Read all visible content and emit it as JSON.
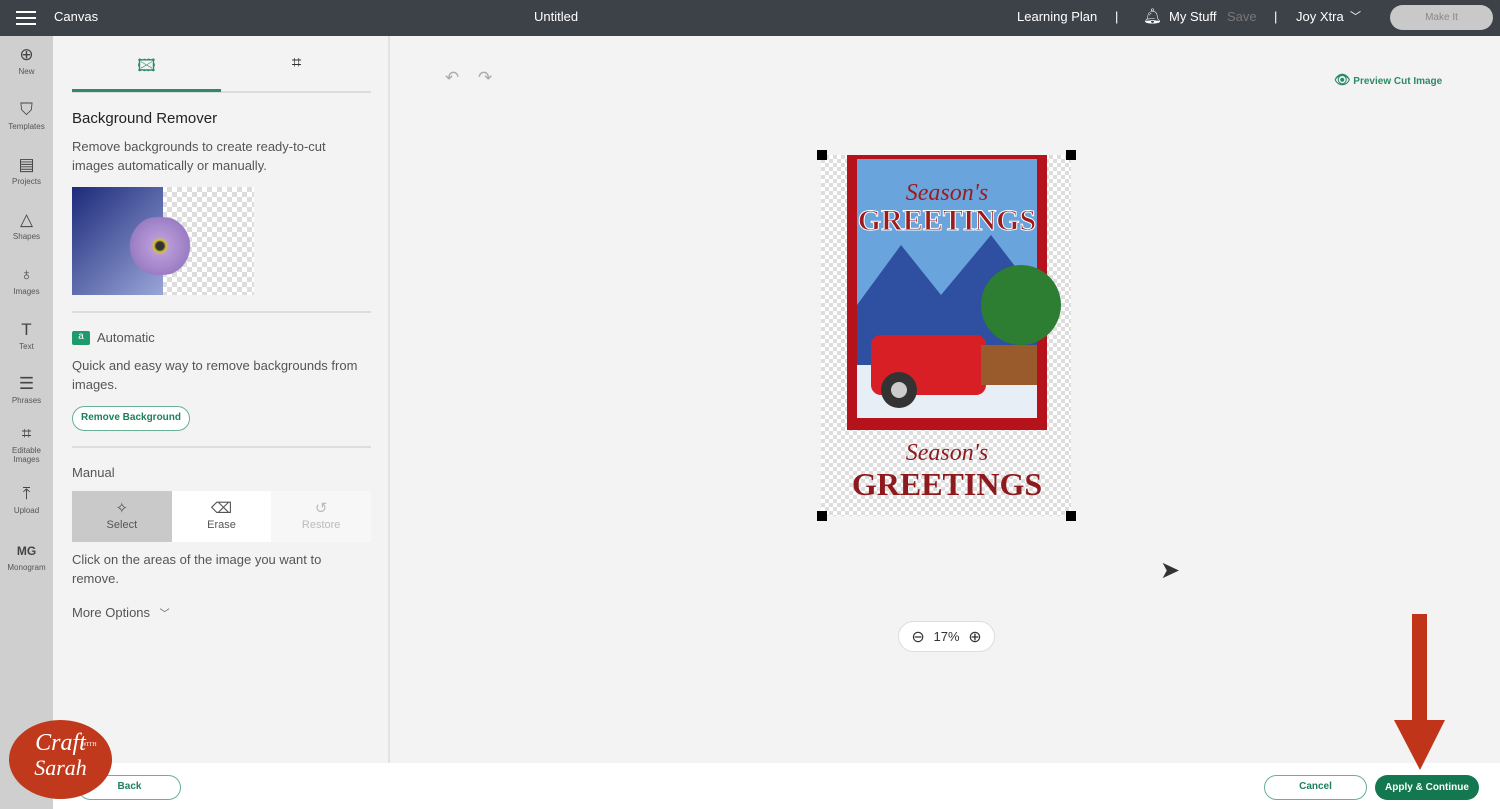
{
  "topbar": {
    "menu_icon": "hamburger-icon",
    "app": "Canvas",
    "title": "Untitled",
    "learning": "Learning Plan",
    "sep": "|",
    "mystuff": "My Stuff",
    "save": "Save",
    "user": "Joy Xtra",
    "make_it": "Make It"
  },
  "rail": [
    {
      "label": "New",
      "icon": "⊕"
    },
    {
      "label": "Templates",
      "icon": "👕"
    },
    {
      "label": "Projects",
      "icon": "▤"
    },
    {
      "label": "Shapes",
      "icon": "△"
    },
    {
      "label": "Images",
      "icon": "♁"
    },
    {
      "label": "Text",
      "icon": "T"
    },
    {
      "label": "Phrases",
      "icon": "☰"
    },
    {
      "label": "Editable Images",
      "icon": "⌗"
    },
    {
      "label": "Upload",
      "icon": "⤒"
    },
    {
      "label": "Monogram",
      "icon": "MG"
    }
  ],
  "panel": {
    "title": "Background Remover",
    "desc": "Remove backgrounds to create ready-to-cut images automatically or manually.",
    "auto_title": "Automatic",
    "auto_desc": "Quick and easy way to remove backgrounds from images.",
    "remove_bg": "Remove Background",
    "manual": "Manual",
    "tools": [
      {
        "label": "Select",
        "icon": "✧"
      },
      {
        "label": "Erase",
        "icon": "⌫"
      },
      {
        "label": "Restore",
        "icon": "↺"
      }
    ],
    "manual_desc": "Click on the areas of the image you want to remove.",
    "more": "More Options"
  },
  "canvas": {
    "preview": "Preview Cut Image",
    "zoom": "17%",
    "image_text_1": "Season's",
    "image_text_2": "GREETINGS"
  },
  "watermark": {
    "line1": "Craft",
    "with": "WITH",
    "line2": "Sarah"
  },
  "bottom": {
    "back": "Back",
    "cancel": "Cancel",
    "apply": "Apply & Continue"
  },
  "colors": {
    "accent": "#1e7f5b",
    "topbar": "#3d4148",
    "arrow": "#c0351a"
  }
}
